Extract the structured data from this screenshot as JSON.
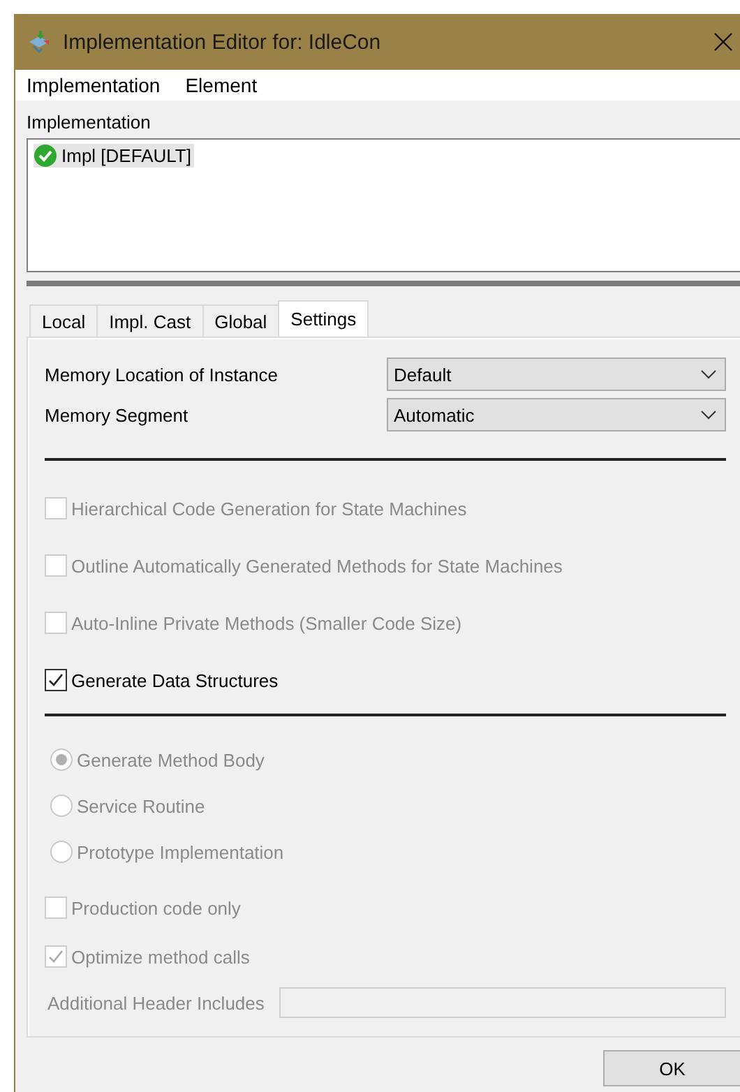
{
  "window": {
    "title": "Implementation Editor for: IdleCon"
  },
  "menu": [
    "Implementation",
    "Element"
  ],
  "implementation": {
    "label": "Implementation",
    "items": [
      {
        "label": "Impl [DEFAULT]",
        "selected": true
      }
    ]
  },
  "tabs": [
    {
      "label": "Local",
      "selected": false
    },
    {
      "label": "Impl. Cast",
      "selected": false
    },
    {
      "label": "Global",
      "selected": false
    },
    {
      "label": "Settings",
      "selected": true
    }
  ],
  "settings": {
    "dropdowns": [
      {
        "label": "Memory Location of Instance",
        "value": "Default"
      },
      {
        "label": "Memory Segment",
        "value": "Automatic"
      }
    ],
    "groups": [
      [
        {
          "kind": "checkbox",
          "label": "Hierarchical Code Generation for State Machines",
          "checked": false,
          "disabled": true
        },
        {
          "kind": "checkbox",
          "label": "Outline Automatically Generated Methods for State Machines",
          "checked": false,
          "disabled": true
        },
        {
          "kind": "checkbox",
          "label": "Auto-Inline Private Methods (Smaller Code Size)",
          "checked": false,
          "disabled": true
        },
        {
          "kind": "checkbox",
          "label": "Generate Data Structures",
          "checked": true,
          "disabled": false
        }
      ],
      [
        {
          "kind": "radio",
          "label": "Generate Method Body",
          "checked": true,
          "disabled": true
        },
        {
          "kind": "radio",
          "label": "Service Routine",
          "checked": false,
          "disabled": true
        },
        {
          "kind": "radio",
          "label": "Prototype Implementation",
          "checked": false,
          "disabled": true
        },
        {
          "kind": "checkbox",
          "label": "Production code only",
          "checked": false,
          "disabled": true
        },
        {
          "kind": "checkbox",
          "label": "Optimize method calls",
          "checked": true,
          "disabled": true
        },
        {
          "kind": "field",
          "label": "Additional Header Includes",
          "disabled": true
        }
      ]
    ]
  },
  "buttons": [
    "OK"
  ]
}
